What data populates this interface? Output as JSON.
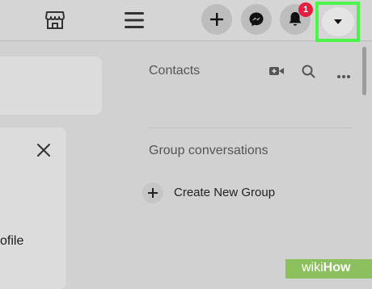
{
  "topbar": {
    "notification_count": "1",
    "highlight_color": "#4cf44c",
    "icons": [
      "marketplace-icon",
      "menu-icon",
      "plus-icon",
      "messenger-icon",
      "bell-icon",
      "chevron-down-icon"
    ]
  },
  "left": {
    "profile_fragment": "ofile"
  },
  "contacts": {
    "title": "Contacts"
  },
  "groups": {
    "title": "Group conversations",
    "create_label": "Create New Group"
  },
  "watermark": {
    "prefix": "wiki",
    "suffix": "How"
  }
}
